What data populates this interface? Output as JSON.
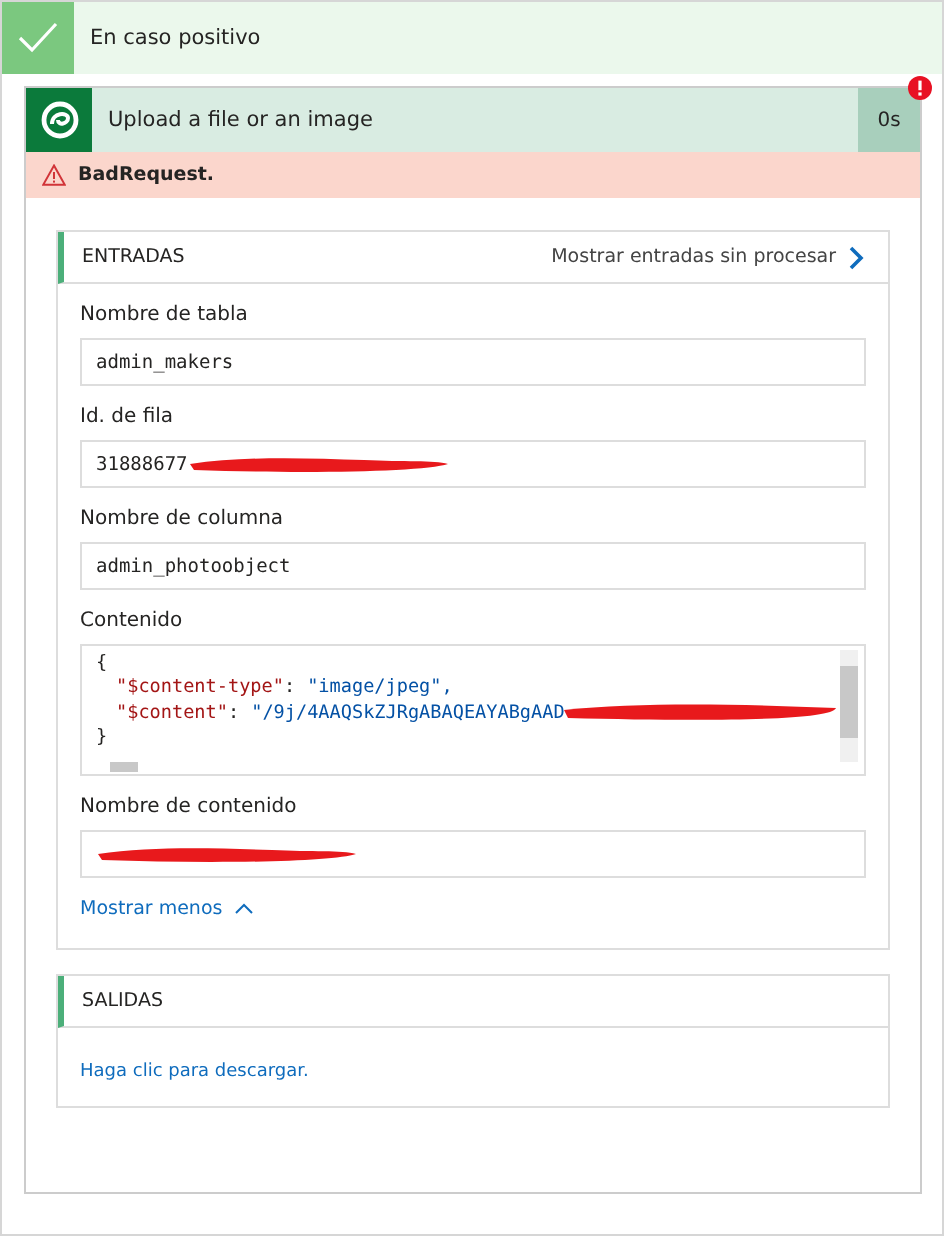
{
  "branch": {
    "title": "En caso positivo"
  },
  "action": {
    "title": "Upload a file or an image",
    "duration": "0s",
    "error_badge": true,
    "error": "BadRequest."
  },
  "inputs": {
    "title": "ENTRADAS",
    "raw_link": "Mostrar entradas sin procesar",
    "fields": [
      {
        "kind": "text",
        "label": "Nombre de tabla",
        "value": "admin_makers",
        "redacted": false
      },
      {
        "kind": "text",
        "label": "Id. de fila",
        "value": "31888677",
        "redacted": true
      },
      {
        "kind": "text",
        "label": "Nombre de columna",
        "value": "admin_photoobject",
        "redacted": false
      },
      {
        "kind": "code",
        "label": "Contenido",
        "lines": [
          {
            "kind": "brace",
            "text": "{"
          },
          {
            "kind": "pair",
            "key": "\"$content-type\"",
            "sep": ":",
            "value": "\"image/jpeg\",",
            "redacted": false
          },
          {
            "kind": "pair",
            "key": "\"$content\"",
            "sep": ":",
            "value": "\"/9j/4AAQSkZJRgABAQEAYABgAAD",
            "redacted": true
          },
          {
            "kind": "brace",
            "text": "}"
          }
        ]
      },
      {
        "kind": "text",
        "label": "Nombre de contenido",
        "redacted": true
      }
    ],
    "less_link": "Mostrar menos"
  },
  "outputs": {
    "title": "SALIDAS",
    "download_link": "Haga clic para descargar."
  }
}
